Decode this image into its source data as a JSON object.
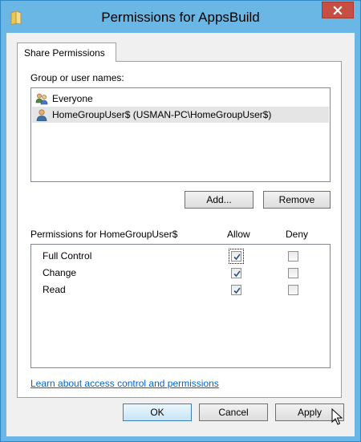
{
  "window": {
    "title": "Permissions for AppsBuild",
    "close_glyph": "✕",
    "accent_color": "#6ab7e6"
  },
  "tabs": [
    {
      "label": "Share Permissions",
      "active": true
    }
  ],
  "users_section": {
    "label": "Group or user names:",
    "users": [
      {
        "name": "Everyone",
        "icon": "group-icon",
        "selected": false
      },
      {
        "name": "HomeGroupUser$ (USMAN-PC\\HomeGroupUser$)",
        "icon": "user-icon",
        "selected": true
      }
    ],
    "add_button": "Add...",
    "remove_button": "Remove"
  },
  "permissions_section": {
    "label": "Permissions for HomeGroupUser$",
    "allow_header": "Allow",
    "deny_header": "Deny",
    "rows": [
      {
        "name": "Full Control",
        "allow": true,
        "deny": false
      },
      {
        "name": "Change",
        "allow": true,
        "deny": false
      },
      {
        "name": "Read",
        "allow": true,
        "deny": false
      }
    ]
  },
  "learn_link": "Learn about access control and permissions",
  "footer": {
    "ok": "OK",
    "cancel": "Cancel",
    "apply": "Apply"
  }
}
